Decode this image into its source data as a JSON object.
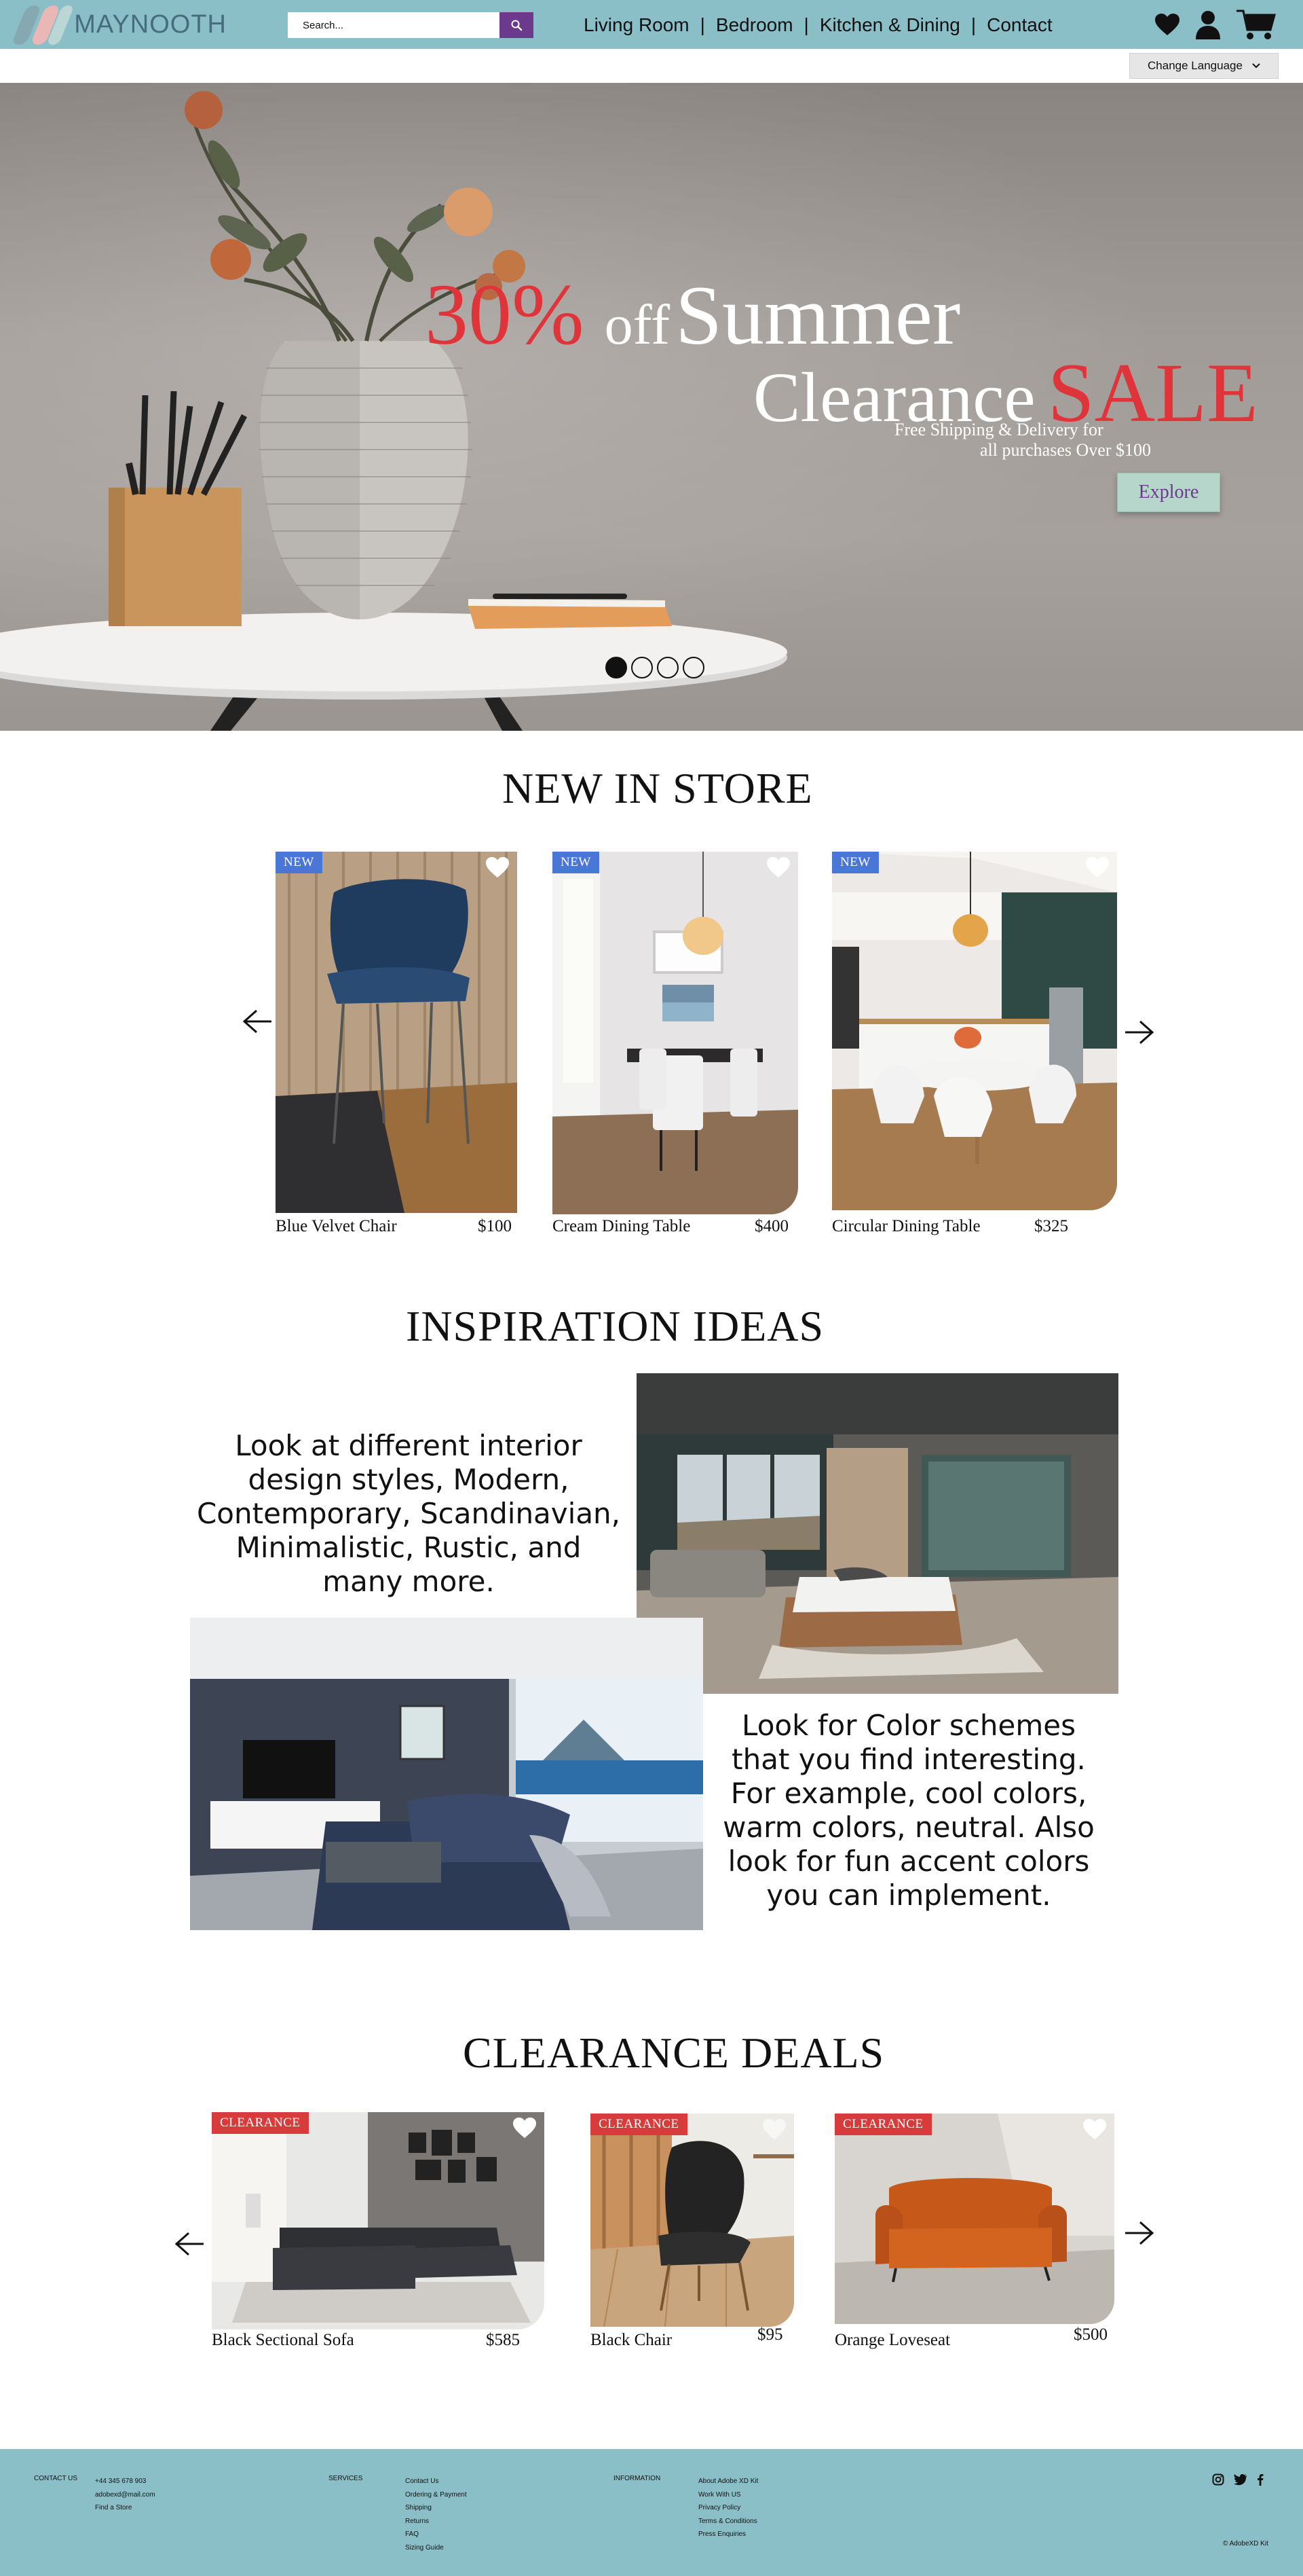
{
  "header": {
    "logo_text": "MAYNOOTH",
    "search_placeholder": "Search...",
    "nav": [
      "Living Room",
      "Bedroom",
      "Kitchen & Dining",
      "Contact"
    ],
    "icons": [
      "search-icon",
      "heart-icon",
      "user-icon",
      "cart-icon"
    ]
  },
  "language": {
    "label": "Change Language"
  },
  "hero": {
    "percent": "30%",
    "off": "off",
    "summer": "Summer",
    "clearance": "Clearance",
    "sale": "SALE",
    "sub_line1": "Free Shipping & Delivery for",
    "sub_line2": "all purchases Over $100",
    "button": "Explore",
    "slides": 4,
    "active_slide": 1
  },
  "new_in_store": {
    "title": "NEW IN STORE",
    "items": [
      {
        "badge": "NEW",
        "name": "Blue Velvet Chair",
        "price": "$100"
      },
      {
        "badge": "NEW",
        "name": "Cream Dining Table",
        "price": "$400"
      },
      {
        "badge": "NEW",
        "name": "Circular Dining Table",
        "price": "$325"
      }
    ]
  },
  "inspiration": {
    "title": "INSPIRATION IDEAS",
    "text1": "Look at different interior design styles, Modern, Contemporary, Scandinavian, Minimalistic, Rustic, and many more.",
    "text2": "Look for Color schemes that you find interesting. For example, cool colors, warm colors, neutral. Also look for fun accent colors you can implement."
  },
  "clearance": {
    "title": "CLEARANCE DEALS",
    "items": [
      {
        "badge": "CLEARANCE",
        "name": "Black Sectional Sofa",
        "price": "$585"
      },
      {
        "badge": "CLEARANCE",
        "name": "Black Chair",
        "price": "$95"
      },
      {
        "badge": "CLEARANCE",
        "name": "Orange Loveseat",
        "price": "$500"
      }
    ]
  },
  "footer": {
    "contact_head": "CONTACT US",
    "contact": [
      "+44 345 678 903",
      "adobexd@mail.com",
      "Find a Store"
    ],
    "services_head": "SERVICES",
    "services": [
      "Contact Us",
      "Ordering & Payment",
      "Shipping",
      "Returns",
      "FAQ",
      "Sizing Guide"
    ],
    "info_head": "INFORMATION",
    "info": [
      "About Adobe XD Kit",
      "Work With US",
      "Privacy Policy",
      "Terms & Conditions",
      "Press Enquiries"
    ],
    "socials": [
      "instagram-icon",
      "twitter-icon",
      "facebook-icon"
    ],
    "copyright": "© AdobeXD Kit"
  },
  "colors": {
    "header_bg": "#8bbfc8",
    "accent_red": "#e0343b",
    "search_button": "#6b3a8c",
    "new_badge": "#4a76d8",
    "clearance_badge": "#d83b3b"
  }
}
